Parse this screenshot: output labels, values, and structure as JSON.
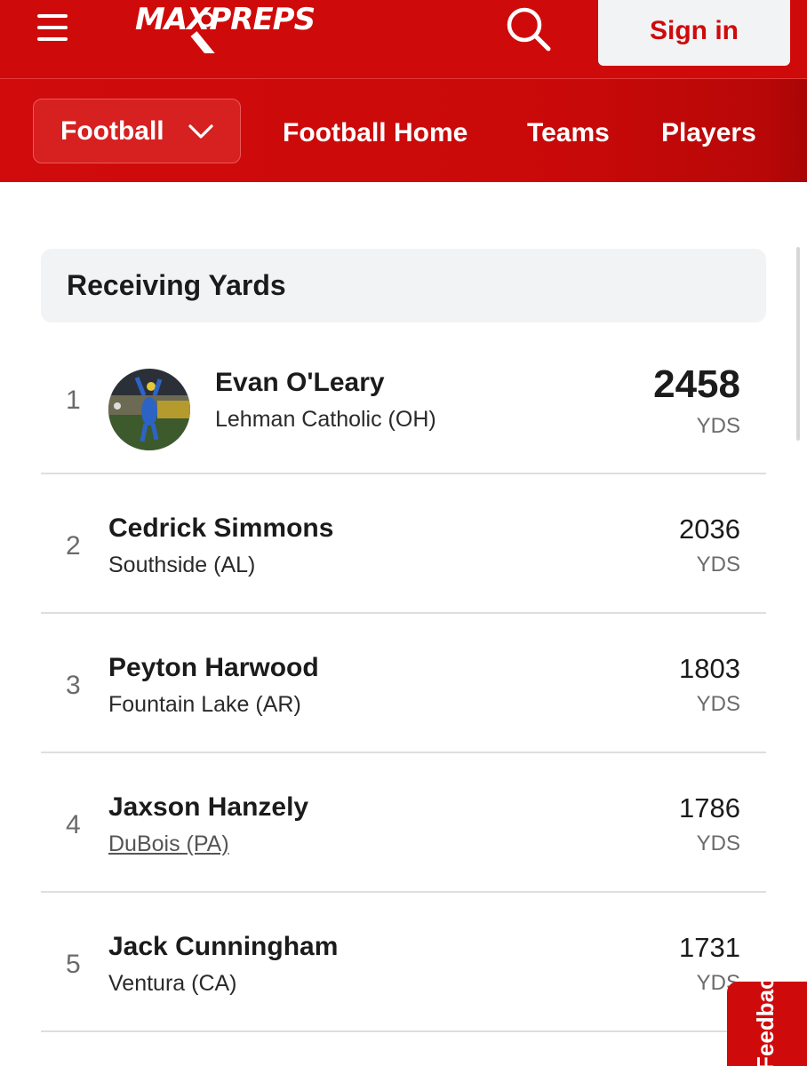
{
  "header": {
    "logo_text": "MAXPREPS",
    "sign_in_label": "Sign in"
  },
  "subnav": {
    "sport": "Football",
    "links": [
      "Football Home",
      "Teams",
      "Players"
    ]
  },
  "stat_card": {
    "title": "Receiving Yards",
    "rows": [
      {
        "rank": "1",
        "name": "Evan O'Leary",
        "school": "Lehman Catholic (OH)",
        "value": "2458",
        "unit": "YDS"
      },
      {
        "rank": "2",
        "name": "Cedrick Simmons",
        "school": "Southside (AL)",
        "value": "2036",
        "unit": "YDS"
      },
      {
        "rank": "3",
        "name": "Peyton Harwood",
        "school": "Fountain Lake (AR)",
        "value": "1803",
        "unit": "YDS"
      },
      {
        "rank": "4",
        "name": "Jaxson Hanzely",
        "school": "DuBois (PA)",
        "value": "1786",
        "unit": "YDS"
      },
      {
        "rank": "5",
        "name": "Jack Cunningham",
        "school": "Ventura (CA)",
        "value": "1731",
        "unit": "YDS"
      }
    ]
  },
  "feedback_tab": {
    "label": "Feedback"
  },
  "colors": {
    "brand_red": "#cf0a0a",
    "card_header_bg": "#f2f3f5",
    "muted_text": "#6b6b6b"
  },
  "icons": [
    "menu-icon",
    "search-icon",
    "chevron-down-icon",
    "player-photo"
  ]
}
